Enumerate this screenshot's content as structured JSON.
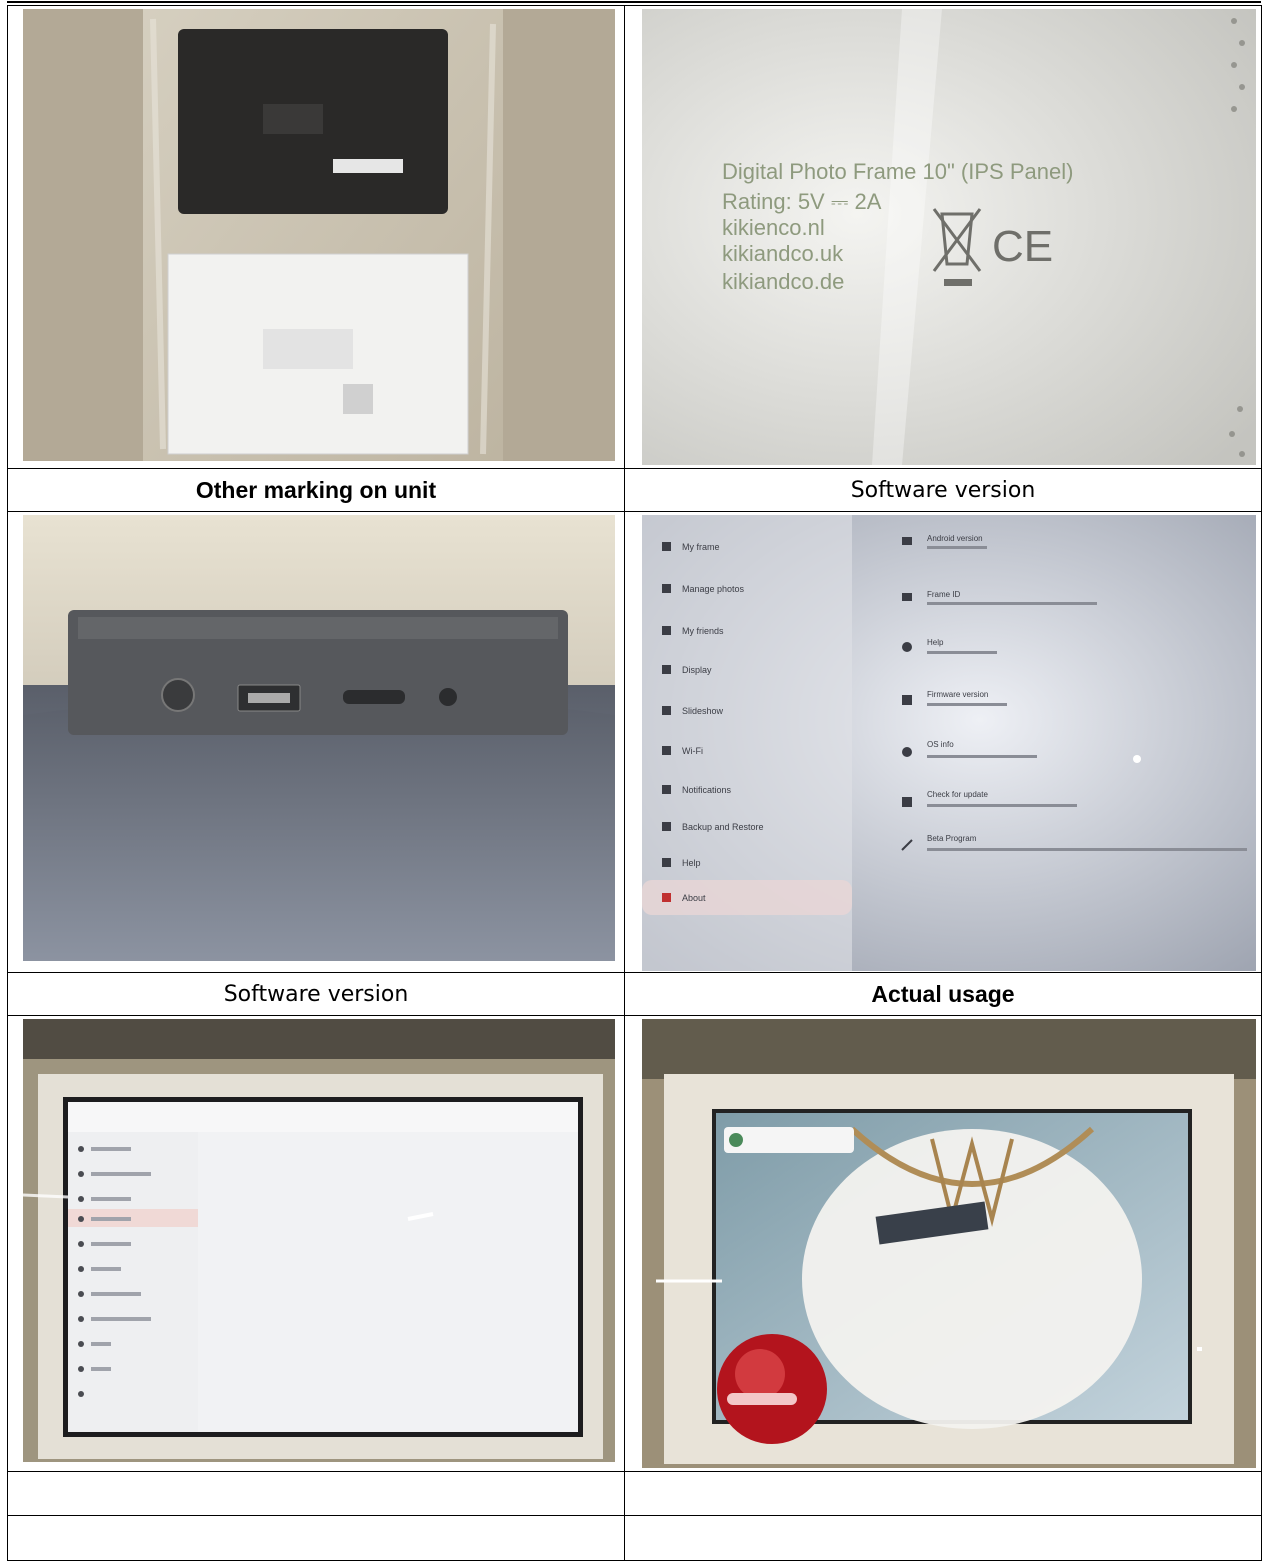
{
  "rows": [
    {
      "left": {
        "photo": "frames-in-packaging",
        "caption": "Other marking on unit",
        "caption_bold": true
      },
      "right": {
        "photo": "rating-label-closeup",
        "caption": "Software version",
        "caption_bold": false,
        "label_lines": [
          "Digital Photo Frame 10\" (IPS Panel)",
          "Rating: 5V ⎓ 2A",
          "kikienco.nl",
          "kikiandco.uk",
          "kikiandco.de"
        ],
        "marks": [
          "weee-bin-icon",
          "ce-mark"
        ]
      }
    },
    {
      "left": {
        "photo": "unit-side-ports",
        "caption": "Software version",
        "caption_bold": false
      },
      "right": {
        "photo": "settings-about-screen",
        "caption": "Actual usage",
        "caption_bold": true,
        "menu_items": [
          "My frame",
          "Manage photos",
          "My friends",
          "Display",
          "Slideshow",
          "Wi-Fi",
          "Notifications",
          "Backup and Restore",
          "Help",
          "About"
        ],
        "detail_items": [
          "Android version",
          "Frame ID",
          "Help",
          "Firmware version",
          "OS info",
          "Check for update",
          "Beta Program"
        ]
      }
    },
    {
      "left": {
        "photo": "frame-settings-screen",
        "caption": "",
        "caption_bold": false
      },
      "right": {
        "photo": "frame-in-use-photo",
        "caption": "",
        "caption_bold": false
      }
    }
  ],
  "colors": {
    "border": "#000000",
    "text": "#000000"
  }
}
